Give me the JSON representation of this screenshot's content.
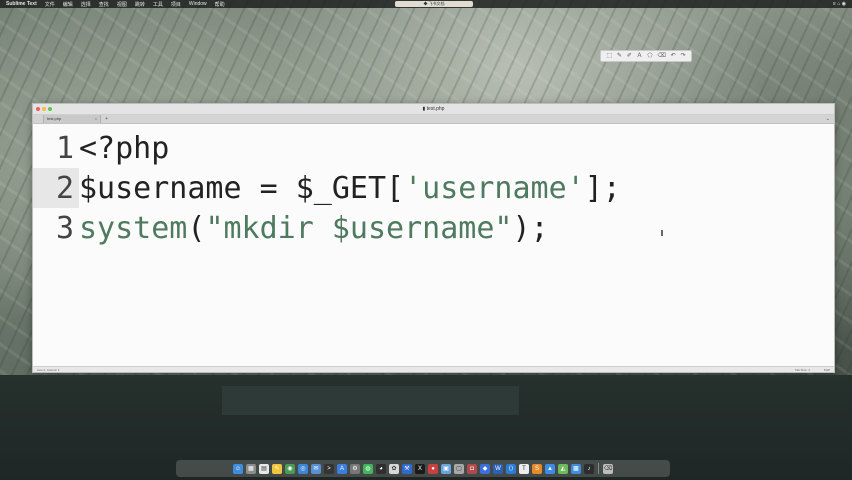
{
  "menubar": {
    "app_name": "Sublime Text",
    "items": [
      "文件",
      "编辑",
      "选择",
      "查找",
      "视图",
      "跳转",
      "工具",
      "项目",
      "Window",
      "帮助"
    ],
    "center_tab": "◆ 飞书文档",
    "right_text": "≡ ⌂ ◉"
  },
  "floating_toolbar": {
    "icons": [
      "select-icon",
      "pen-icon",
      "highlight-icon",
      "text-icon",
      "shape-icon",
      "eraser-icon",
      "undo-icon",
      "redo-icon"
    ],
    "glyphs": [
      "⬚",
      "✎",
      "✐",
      "Ａ",
      "⬠",
      "⌫",
      "↶",
      "↷"
    ]
  },
  "window": {
    "title": "▮ test.php",
    "tab_label": "test.php",
    "tab_close": "×",
    "new_tab": "+",
    "tab_menu": "⌄",
    "status_left": "Line 2, Column 1",
    "status_right": [
      "Tab Size: 4",
      "PHP"
    ]
  },
  "code": {
    "lines": [
      {
        "num": "1",
        "parts": [
          {
            "text": "<?php",
            "type": "plain"
          }
        ]
      },
      {
        "num": "2",
        "parts": [
          {
            "text": "$username = $_GET[",
            "type": "plain"
          },
          {
            "text": "'username'",
            "type": "str"
          },
          {
            "text": "];",
            "type": "plain"
          }
        ]
      },
      {
        "num": "3",
        "parts": [
          {
            "text": "system",
            "type": "fn"
          },
          {
            "text": "(",
            "type": "plain"
          },
          {
            "text": "\"mkdir $username\"",
            "type": "str"
          },
          {
            "text": ");",
            "type": "plain"
          }
        ]
      }
    ],
    "active_line": 2
  },
  "dock": {
    "apps": [
      {
        "name": "finder-icon",
        "color": "#3f8ede",
        "glyph": "☺"
      },
      {
        "name": "launchpad-icon",
        "color": "#8c8c8c",
        "glyph": "▦"
      },
      {
        "name": "calendar-icon",
        "color": "#e8e8e8",
        "glyph": "▤"
      },
      {
        "name": "notes-icon",
        "color": "#f0c63c",
        "glyph": "✎"
      },
      {
        "name": "chrome-icon",
        "color": "#4b9a55",
        "glyph": "◉"
      },
      {
        "name": "safari-icon",
        "color": "#3d86d8",
        "glyph": "◎"
      },
      {
        "name": "mail-icon",
        "color": "#5790d4",
        "glyph": "✉"
      },
      {
        "name": "terminal-icon",
        "color": "#333333",
        "glyph": ">"
      },
      {
        "name": "appstore-icon",
        "color": "#3b7ee0",
        "glyph": "A"
      },
      {
        "name": "settings-icon",
        "color": "#777777",
        "glyph": "⚙"
      },
      {
        "name": "wechat-icon",
        "color": "#3fb55c",
        "glyph": "◍"
      },
      {
        "name": "qq-icon",
        "color": "#2f2f2f",
        "glyph": "◕"
      },
      {
        "name": "photos-icon",
        "color": "#d8d8d8",
        "glyph": "✿"
      },
      {
        "name": "xcode-icon",
        "color": "#2f6ad3",
        "glyph": "⚒"
      },
      {
        "name": "x-icon",
        "color": "#1a1a1a",
        "glyph": "X"
      },
      {
        "name": "record-icon",
        "color": "#c94040",
        "glyph": "●"
      },
      {
        "name": "preview-icon",
        "color": "#6aa4e0",
        "glyph": "▣"
      },
      {
        "name": "files-icon",
        "color": "#a9a9a9",
        "glyph": "▢"
      },
      {
        "name": "photo-booth-icon",
        "color": "#b04a4a",
        "glyph": "◘"
      },
      {
        "name": "feishu-icon",
        "color": "#3a6fdc",
        "glyph": "◆"
      },
      {
        "name": "word-icon",
        "color": "#2d5fb3",
        "glyph": "W"
      },
      {
        "name": "vscode-icon",
        "color": "#2a7bd4",
        "glyph": "⟨⟩"
      },
      {
        "name": "typora-icon",
        "color": "#ededed",
        "glyph": "T"
      },
      {
        "name": "sublime-icon",
        "color": "#e48a2a",
        "glyph": "S"
      },
      {
        "name": "keynote-icon",
        "color": "#3c8de6",
        "glyph": "▲"
      },
      {
        "name": "maps-icon",
        "color": "#6cbb5a",
        "glyph": "◭"
      },
      {
        "name": "docker-icon",
        "color": "#3d8de0",
        "glyph": "▩"
      },
      {
        "name": "activity-icon",
        "color": "#2d2d2d",
        "glyph": "♪"
      }
    ],
    "trash": {
      "name": "trash-icon",
      "color": "#bdbdbd",
      "glyph": "⌫"
    }
  }
}
